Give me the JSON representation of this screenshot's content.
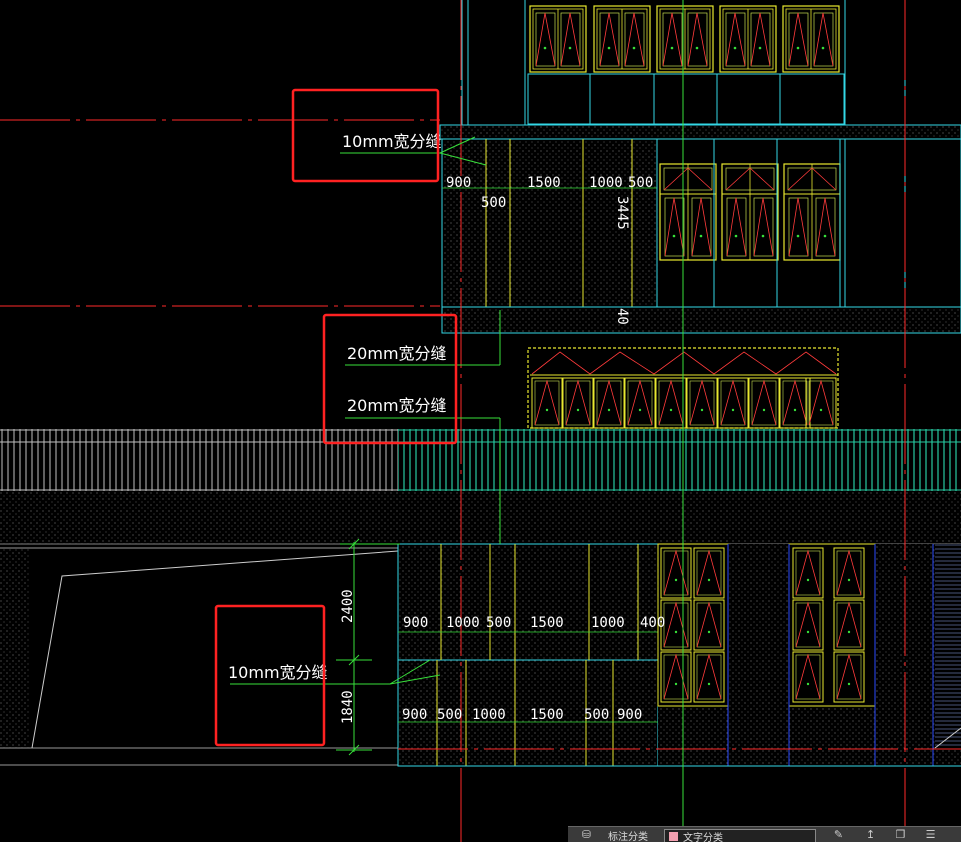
{
  "colors": {
    "background": "#000000",
    "axis_red": "#ff2a2a",
    "wall_cyan": "#33d7e6",
    "window_yellow": "#e8e830",
    "window_red": "#ff3b3b",
    "leader_green": "#37e03a",
    "highlight_box": "#ff2222",
    "railing_teal": "#27c9a0",
    "railing_gray": "#bfbfbf",
    "text_white": "#ffffff",
    "blue_line": "#2b4cff"
  },
  "annotations": {
    "joint_top": "10mm宽分缝",
    "joint_mid_1": "20mm宽分缝",
    "joint_mid_2": "20mm宽分缝",
    "joint_bottom": "10mm宽分缝"
  },
  "dims_upper": {
    "d900": "900",
    "d1500": "1500",
    "d1000": "1000",
    "d500a": "500",
    "d500b": "500",
    "d3445": "3445",
    "d40": "40"
  },
  "dims_lower_row1": {
    "d900": "900",
    "d1000a": "1000",
    "d500": "500",
    "d1500": "1500",
    "d1000b": "1000",
    "d400": "400"
  },
  "dims_lower_row2": {
    "d900a": "900",
    "d500a": "500",
    "d1000": "1000",
    "d1500": "1500",
    "d500b": "500",
    "d900b": "900"
  },
  "dims_vertical": {
    "h2400": "2400",
    "h1840": "1840"
  },
  "statusbar": {
    "layer_label": "标注分类",
    "layer_name": "文字分类"
  },
  "icons": [
    "layer-icon",
    "edit-icon",
    "upload-icon",
    "copy-icon",
    "stack-icon"
  ]
}
